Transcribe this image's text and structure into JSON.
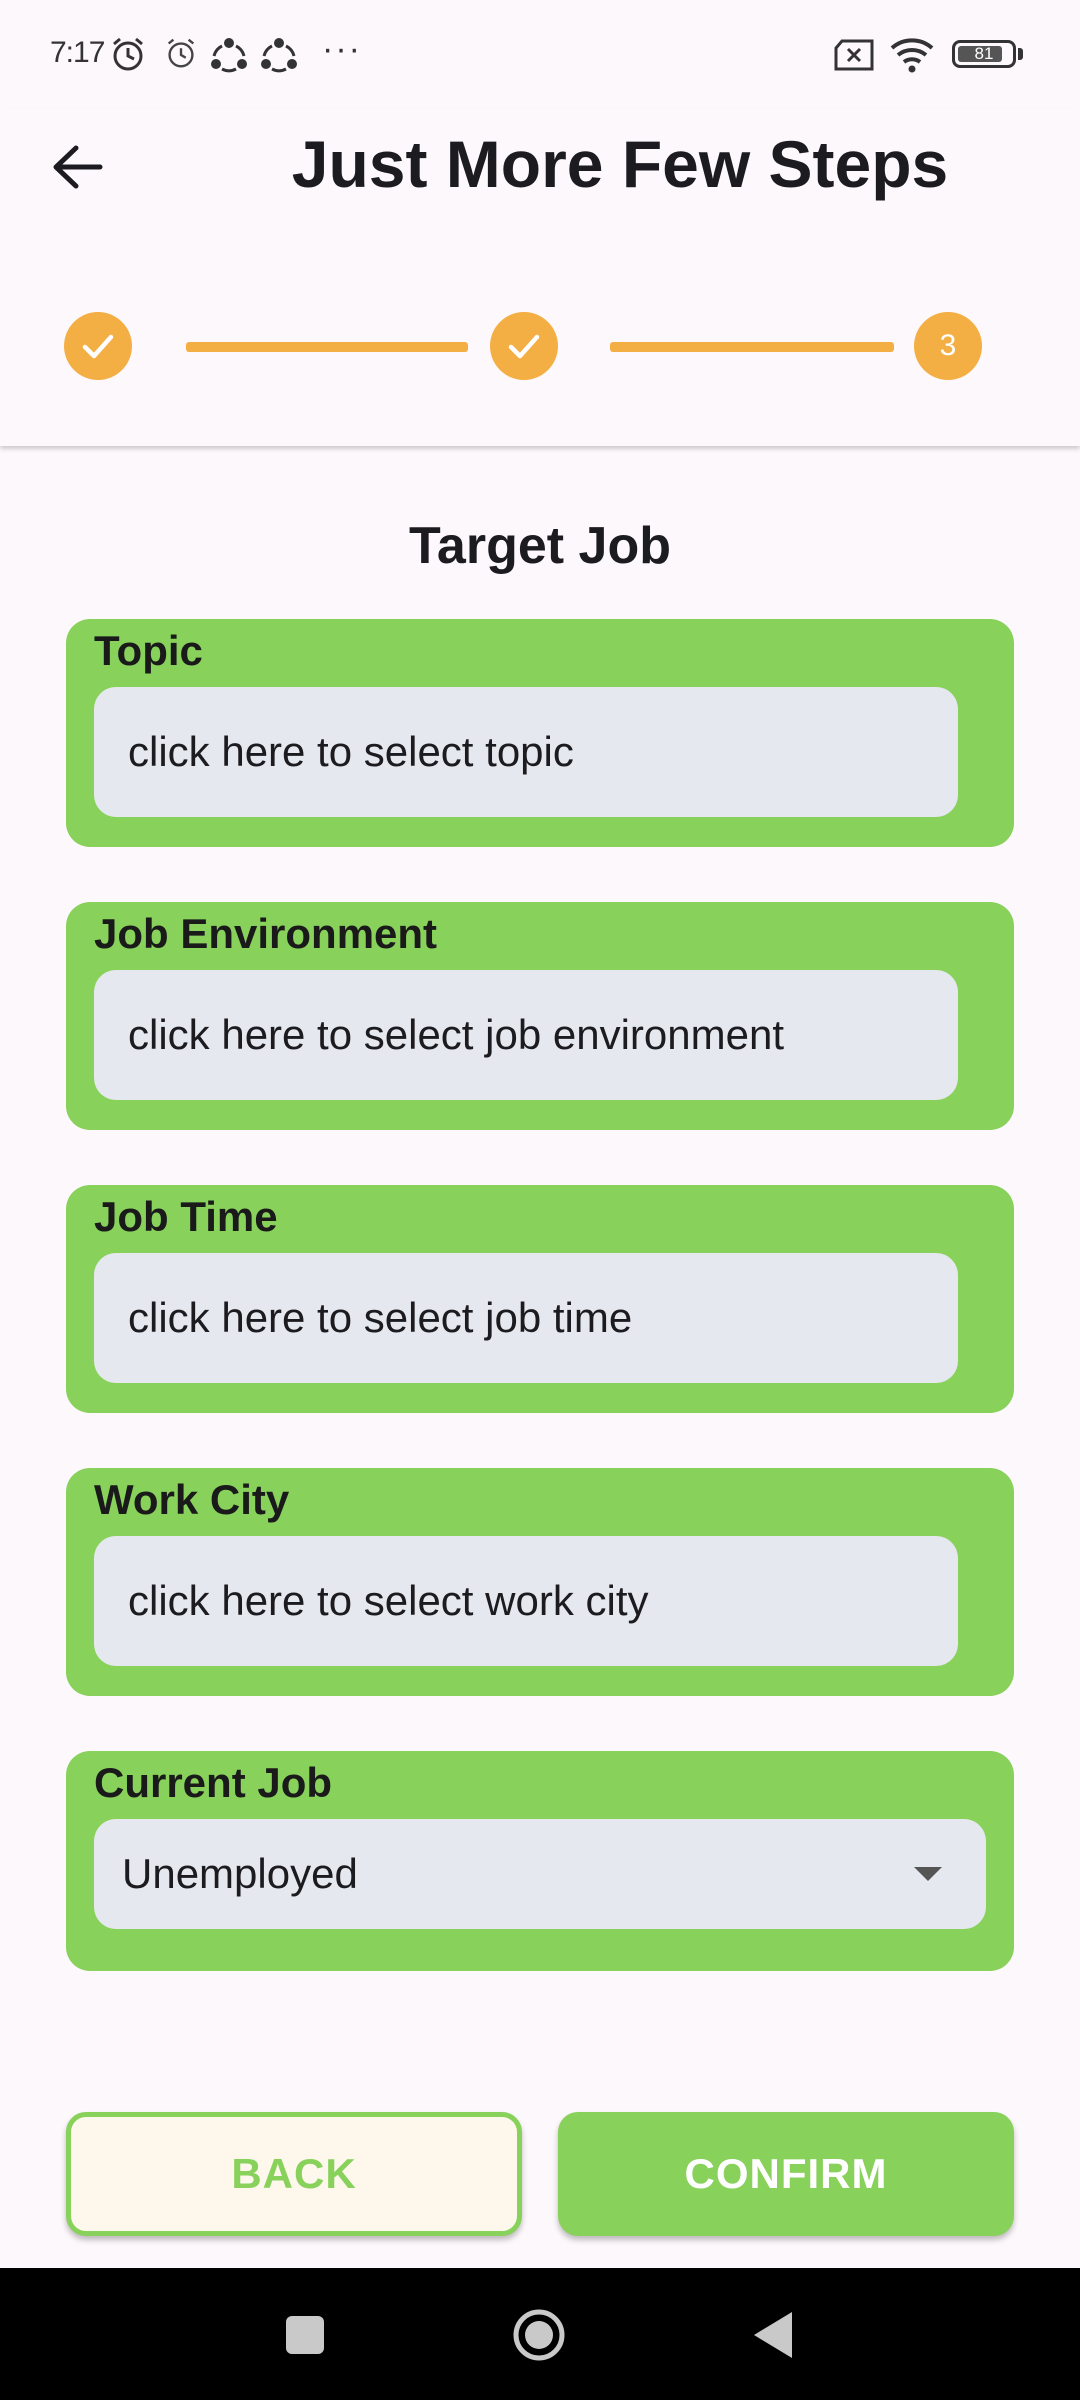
{
  "status_bar": {
    "time": "7:17",
    "more_indicator": "···",
    "battery": "81"
  },
  "header": {
    "title": "Just More Few Steps",
    "steps": [
      {
        "state": "done"
      },
      {
        "state": "done"
      },
      {
        "state": "current",
        "number": "3"
      }
    ]
  },
  "form": {
    "section_title": "Target Job",
    "fields": [
      {
        "label": "Topic",
        "placeholder": "click here to select topic"
      },
      {
        "label": "Job Environment",
        "placeholder": "click here to select job environment"
      },
      {
        "label": "Job Time",
        "placeholder": "click here to select job time"
      },
      {
        "label": "Work City",
        "placeholder": "click here to select work city"
      }
    ],
    "current_job": {
      "label": "Current Job",
      "value": "Unemployed"
    }
  },
  "buttons": {
    "back": "BACK",
    "confirm": "CONFIRM"
  },
  "colors": {
    "accent_green": "#88d15b",
    "step_orange": "#f3ae44",
    "field_bg": "#e5e8ee"
  }
}
